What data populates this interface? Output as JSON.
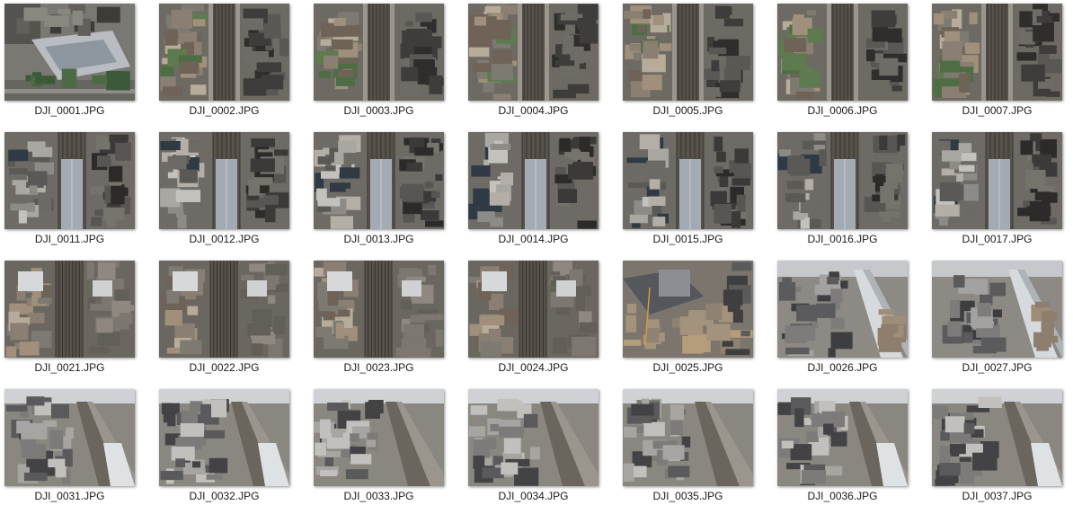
{
  "files": [
    {
      "name": "DJI_0001.JPG",
      "scene": "plaza-icon"
    },
    {
      "name": "DJI_0002.JPG",
      "scene": "railway-aerial-icon"
    },
    {
      "name": "DJI_0003.JPG",
      "scene": "railway-aerial-icon"
    },
    {
      "name": "DJI_0004.JPG",
      "scene": "railway-aerial-icon"
    },
    {
      "name": "DJI_0005.JPG",
      "scene": "railway-aerial-icon"
    },
    {
      "name": "DJI_0006.JPG",
      "scene": "railway-aerial-icon"
    },
    {
      "name": "DJI_0007.JPG",
      "scene": "railway-aerial-icon"
    },
    {
      "name": "DJI_0011.JPG",
      "scene": "station-roof-icon"
    },
    {
      "name": "DJI_0012.JPG",
      "scene": "station-roof-icon"
    },
    {
      "name": "DJI_0013.JPG",
      "scene": "station-roof-icon"
    },
    {
      "name": "DJI_0014.JPG",
      "scene": "station-roof-icon"
    },
    {
      "name": "DJI_0015.JPG",
      "scene": "station-roof-icon"
    },
    {
      "name": "DJI_0016.JPG",
      "scene": "station-roof-icon"
    },
    {
      "name": "DJI_0017.JPG",
      "scene": "station-roof-icon"
    },
    {
      "name": "DJI_0021.JPG",
      "scene": "tracks-buildings-icon"
    },
    {
      "name": "DJI_0022.JPG",
      "scene": "tracks-buildings-icon"
    },
    {
      "name": "DJI_0023.JPG",
      "scene": "tracks-buildings-icon"
    },
    {
      "name": "DJI_0024.JPG",
      "scene": "tracks-buildings-icon"
    },
    {
      "name": "DJI_0025.JPG",
      "scene": "construction-site-icon"
    },
    {
      "name": "DJI_0026.JPG",
      "scene": "oblique-city-icon"
    },
    {
      "name": "DJI_0027.JPG",
      "scene": "oblique-city-icon"
    },
    {
      "name": "DJI_0031.JPG",
      "scene": "oblique-rooftops-icon"
    },
    {
      "name": "DJI_0032.JPG",
      "scene": "oblique-rooftops-icon"
    },
    {
      "name": "DJI_0033.JPG",
      "scene": "oblique-rooftops-icon"
    },
    {
      "name": "DJI_0034.JPG",
      "scene": "oblique-rooftops-icon"
    },
    {
      "name": "DJI_0035.JPG",
      "scene": "oblique-rooftops-icon"
    },
    {
      "name": "DJI_0036.JPG",
      "scene": "oblique-rooftops-icon"
    },
    {
      "name": "DJI_0037.JPG",
      "scene": "oblique-rooftops-icon"
    }
  ],
  "colors": {
    "background": "#ffffff",
    "label_text": "#1a1a1a",
    "track": "#4a4640",
    "roof": "#9fa6ad",
    "building_light": "#cfd2d6",
    "building_dark": "#3f4043"
  }
}
